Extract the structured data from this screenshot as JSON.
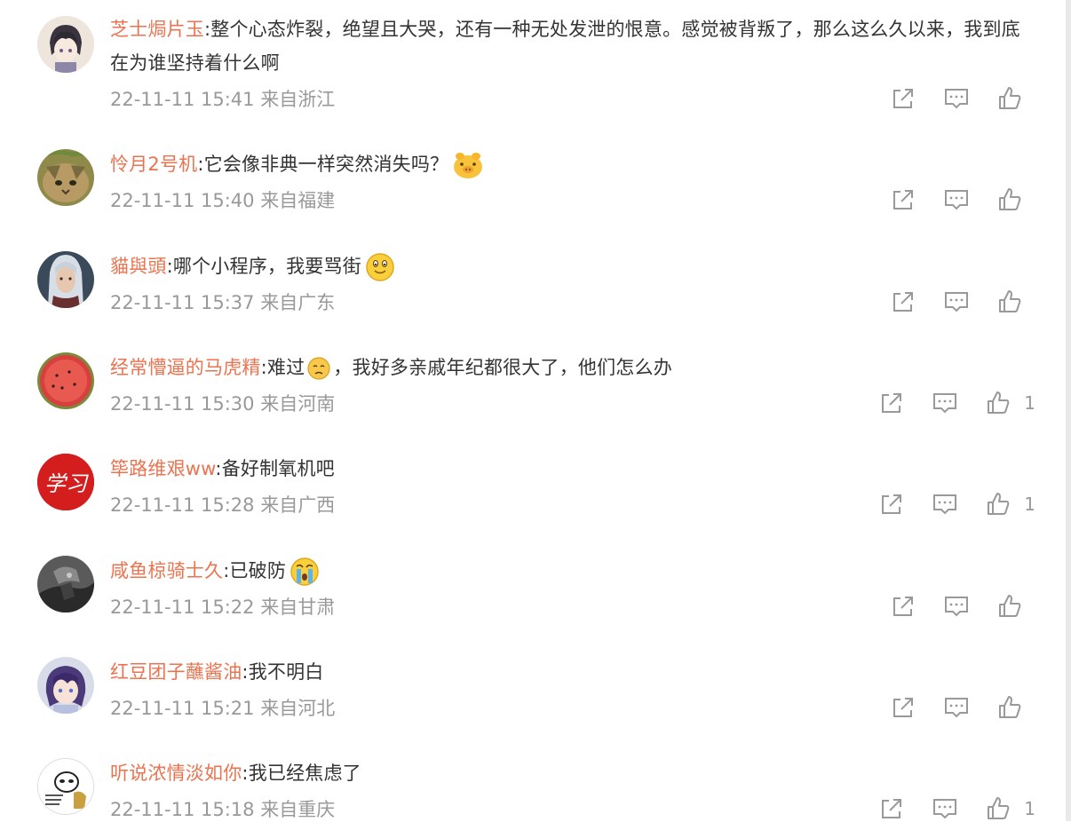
{
  "comments": [
    {
      "user": "芝士焗片玉",
      "text": "整个心态炸裂，绝望且大哭，还有一种无处发泄的恨意。感觉被背叛了，那么这么久以来，我到底在为谁坚持着什么啊",
      "time": "22-11-11 15:41",
      "location": "来自浙江",
      "likes": ""
    },
    {
      "user": "怜月2号机",
      "text": "它会像非典一样突然消失吗？",
      "time": "22-11-11 15:40",
      "location": "来自福建",
      "likes": ""
    },
    {
      "user": "貓與頭",
      "text": "哪个小程序，我要骂街",
      "time": "22-11-11 15:37",
      "location": "来自广东",
      "likes": ""
    },
    {
      "user": "经常懵逼的马虎精",
      "text_a": "难过",
      "text_b": "，我好多亲戚年纪都很大了，他们怎么办",
      "time": "22-11-11 15:30",
      "location": "来自河南",
      "likes": "1"
    },
    {
      "user": "筚路维艰ww",
      "text": "备好制氧机吧",
      "time": "22-11-11 15:28",
      "location": "来自广西",
      "likes": "1"
    },
    {
      "user": "咸鱼椋骑士久",
      "text": "已破防",
      "time": "22-11-11 15:22",
      "location": "来自甘肃",
      "likes": ""
    },
    {
      "user": "红豆团子蘸酱油",
      "text": "我不明白",
      "time": "22-11-11 15:21",
      "location": "来自河北",
      "likes": ""
    },
    {
      "user": "听说浓情淡如你",
      "text": "我已经焦虑了",
      "time": "22-11-11 15:18",
      "location": "来自重庆",
      "likes": "1"
    }
  ],
  "avatar_text": "学习",
  "colors": {
    "username": "#eb7350",
    "meta": "#999999",
    "text": "#333333"
  },
  "icons": [
    "share-icon",
    "comment-icon",
    "like-icon"
  ]
}
